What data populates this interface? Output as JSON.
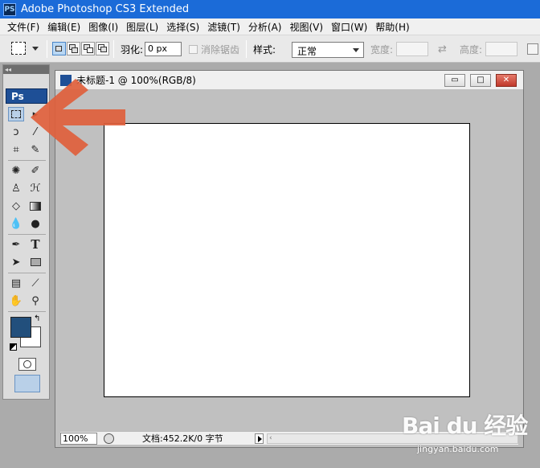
{
  "app": {
    "title": "Adobe Photoshop CS3 Extended",
    "icon": "PS"
  },
  "menu": [
    "文件(F)",
    "编辑(E)",
    "图像(I)",
    "图层(L)",
    "选择(S)",
    "滤镜(T)",
    "分析(A)",
    "视图(V)",
    "窗口(W)",
    "帮助(H)"
  ],
  "options": {
    "feather_label": "羽化:",
    "feather_value": "0 px",
    "antialias_label": "消除锯齿",
    "style_label": "样式:",
    "style_value": "正常",
    "width_label": "宽度:",
    "height_label": "高度:",
    "swap_icon": "⇄"
  },
  "toolbox": {
    "collapse": "◂◂",
    "logo": "Ps",
    "selected_tool": "rectangular-marquee-tool",
    "foreground_color": "#224f7c",
    "background_color": "#ffffff",
    "swap_symbol": "↰"
  },
  "document": {
    "title": "未标题-1 @ 100%(RGB/8)",
    "minimize": "▭",
    "maximize": "□",
    "close": "✕",
    "zoom": "100%",
    "doc_info": "文档:452.2K/0 字节"
  },
  "annotation": {
    "arrow_color": "#e0603c"
  },
  "watermark": {
    "text": "Bai du 经验",
    "sub": "jingyan.baidu.com"
  }
}
